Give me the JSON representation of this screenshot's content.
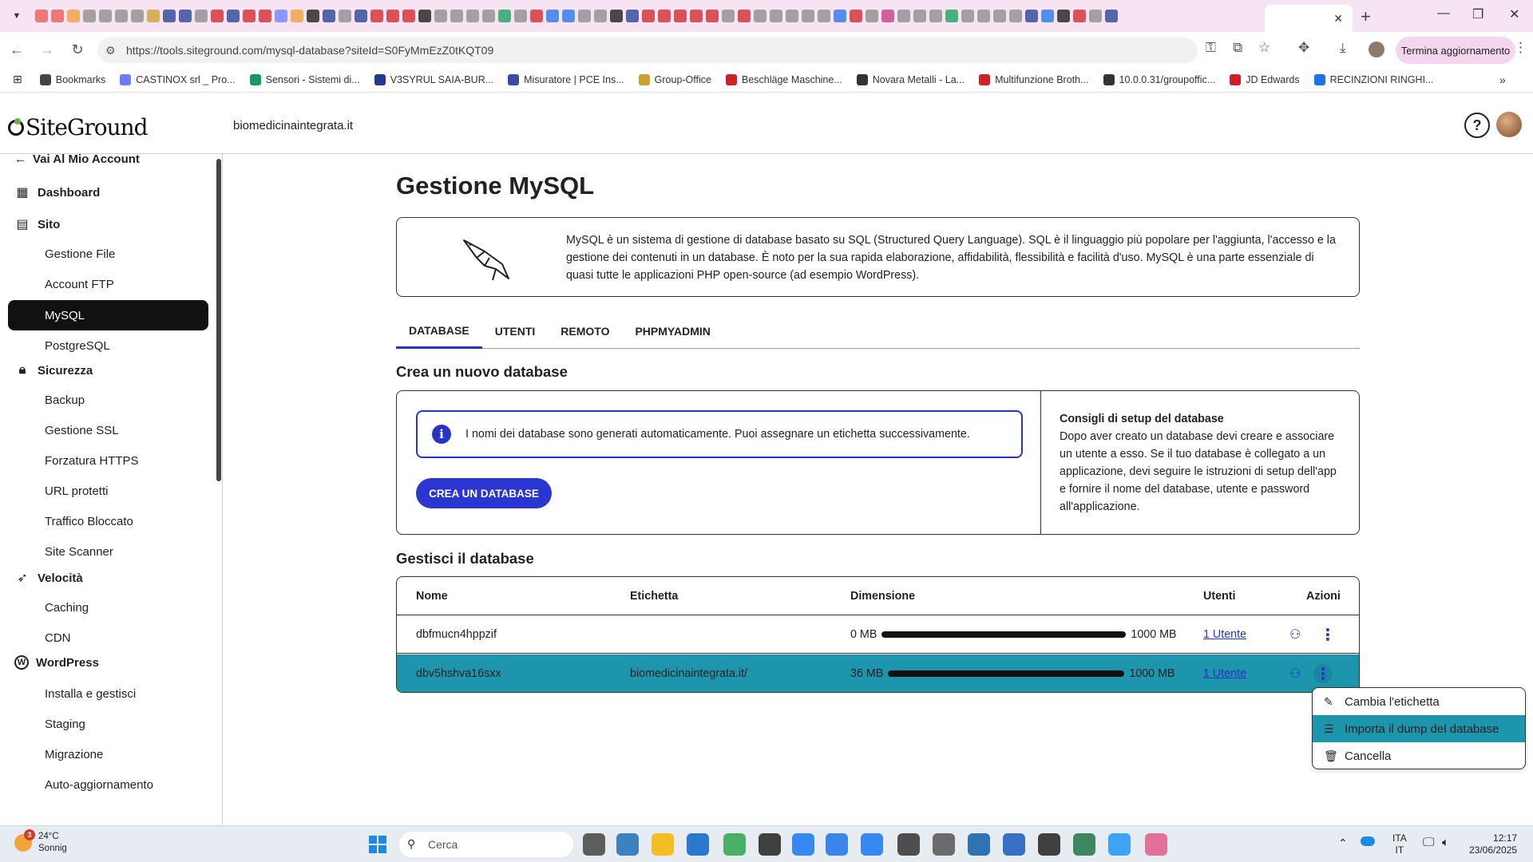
{
  "browser": {
    "url": "https://tools.siteground.com/mysql-database?siteId=S0FyMmEzZ0tKQT09",
    "update_button": "Termina aggiornamento",
    "bookmarks": [
      {
        "label": "Bookmarks",
        "color": "#444444"
      },
      {
        "label": "CASTINOX srl _ Pro...",
        "color": "#6b7cff"
      },
      {
        "label": "Sensori - Sistemi di...",
        "color": "#0f9d58"
      },
      {
        "label": "V3SYRUL SAIA-BUR...",
        "color": "#1f3a93"
      },
      {
        "label": "Misuratore | PCE Ins...",
        "color": "#3b4aa3"
      },
      {
        "label": "Group-Office",
        "color": "#c9a227"
      },
      {
        "label": "Beschläge Maschine...",
        "color": "#d11f26"
      },
      {
        "label": "Novara Metalli - La...",
        "color": "#333333"
      },
      {
        "label": "Multifunzione Broth...",
        "color": "#d11f26"
      },
      {
        "label": "10.0.0.31/groupoffic...",
        "color": "#333333"
      },
      {
        "label": "JD Edwards",
        "color": "#d11f26"
      },
      {
        "label": "RECINZIONI RINGHI...",
        "color": "#1a73e8"
      }
    ]
  },
  "header": {
    "logo": "SiteGround",
    "domain": "biomedicinaintegrata.it",
    "help_icon": "?"
  },
  "sidebar": {
    "back_label": "Vai Al Mio Account",
    "sections": [
      {
        "label": "Dashboard",
        "icon": "grid-icon"
      },
      {
        "label": "Sito",
        "icon": "site-icon"
      },
      {
        "label": "Sicurezza",
        "icon": "lock-icon"
      },
      {
        "label": "Velocità",
        "icon": "rocket-icon"
      },
      {
        "label": "WordPress",
        "icon": "wordpress-icon"
      }
    ],
    "items": [
      {
        "label": "Gestione File"
      },
      {
        "label": "Account FTP"
      },
      {
        "label": "MySQL"
      },
      {
        "label": "PostgreSQL"
      },
      {
        "label": "Backup"
      },
      {
        "label": "Gestione SSL"
      },
      {
        "label": "Forzatura HTTPS"
      },
      {
        "label": "URL protetti"
      },
      {
        "label": "Traffico Bloccato"
      },
      {
        "label": "Site Scanner"
      },
      {
        "label": "Caching"
      },
      {
        "label": "CDN"
      },
      {
        "label": "Installa e gestisci"
      },
      {
        "label": "Staging"
      },
      {
        "label": "Migrazione"
      },
      {
        "label": "Auto-aggiornamento"
      }
    ]
  },
  "main": {
    "title": "Gestione MySQL",
    "intro": "MySQL è un sistema di gestione di database basato su SQL (Structured Query Language). SQL è il linguaggio più popolare per l'aggiunta, l'accesso e la gestione dei contenuti in un database. È noto per la sua rapida elaborazione, affidabilità, flessibilità e facilità d'uso. MySQL è una parte essenziale di quasi tutte le applicazioni PHP open-source (ad esempio WordPress).",
    "tabs": [
      {
        "label": "DATABASE"
      },
      {
        "label": "UTENTI"
      },
      {
        "label": "REMOTO"
      },
      {
        "label": "PHPMYADMIN"
      }
    ],
    "create": {
      "heading": "Crea un nuovo database",
      "notice": "I nomi dei database sono generati automaticamente. Puoi assegnare un etichetta successivamente.",
      "button": "CREA UN DATABASE",
      "tips_title": "Consigli di setup del database",
      "tips_text": "Dopo aver creato un database devi creare e associare un utente a esso. Se il tuo database è collegato a un applicazione, devi seguire le istruzioni di setup dell'app e fornire il nome del database, utente e password all'applicazione."
    },
    "manage": {
      "heading": "Gestisci il database",
      "columns": {
        "name": "Nome",
        "label": "Etichetta",
        "size": "Dimensione",
        "users": "Utenti",
        "actions": "Azioni"
      },
      "rows": [
        {
          "name": "dbfmucn4hppzif",
          "label": "",
          "size": "0 MB",
          "quota": "1000 MB",
          "used_fraction": 0.0,
          "users": "1 Utente"
        },
        {
          "name": "dbv5hshva16sxx",
          "label": "biomedicinaintegrata.it/",
          "size": "36 MB",
          "quota": "1000 MB",
          "used_fraction": 0.036,
          "users": "1 Utente"
        }
      ]
    },
    "context_menu": [
      {
        "label": "Cambia l'etichetta",
        "icon": "pencil-icon"
      },
      {
        "label": "Importa il dump del database",
        "icon": "database-icon"
      },
      {
        "label": "Cancella",
        "icon": "trash-icon"
      }
    ]
  },
  "taskbar": {
    "weather_temp": "24°C",
    "weather_desc": "Sonnig",
    "weather_badge": "3",
    "search_placeholder": "Cerca",
    "lang_top": "ITA",
    "lang_bottom": "IT",
    "time": "12:17",
    "date": "23/06/2025"
  }
}
